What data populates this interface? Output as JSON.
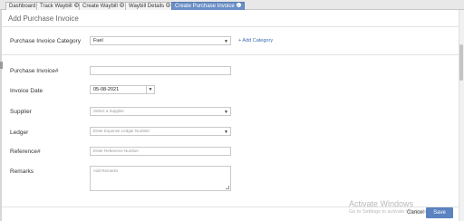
{
  "tabs": [
    {
      "label": "Dashboard",
      "closable": false,
      "active": false
    },
    {
      "label": "Track Waybill",
      "closable": true,
      "active": false
    },
    {
      "label": "Create Waybill",
      "closable": true,
      "active": false
    },
    {
      "label": "Waybill Details",
      "closable": true,
      "active": false
    },
    {
      "label": "Create Purchase Invoice",
      "closable": true,
      "active": true
    }
  ],
  "header": {
    "title": "Add Purchase Invoice"
  },
  "form": {
    "category": {
      "label": "Purchase Invoice Category",
      "value": "Fuel",
      "add_link": "+ Add Category"
    },
    "invoice_no": {
      "label": "Purchase Invoice#",
      "value": ""
    },
    "invoice_date": {
      "label": "Invoice Date",
      "value": "05-08-2021"
    },
    "supplier": {
      "label": "Supplier",
      "placeholder": "Select a Supplier"
    },
    "ledger": {
      "label": "Ledger",
      "placeholder": "Enter Expense Ledger Number"
    },
    "reference": {
      "label": "Reference#",
      "placeholder": "Enter Reference Number"
    },
    "remarks": {
      "label": "Remarks",
      "placeholder": "Add Remarks"
    }
  },
  "footer": {
    "cancel_label": "Cancel",
    "save_label": "Save"
  },
  "watermark": {
    "line1": "Activate Windows",
    "line2": "Go to Settings to activate Windows."
  },
  "colors": {
    "accent": "#5b82c1",
    "active_tab": "#6b8fc7"
  }
}
